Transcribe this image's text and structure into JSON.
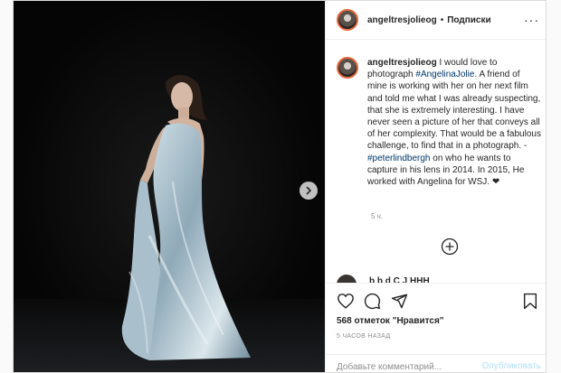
{
  "post": {
    "username": "angeltresjolieog",
    "separator": "•",
    "follow_label": "Подписки",
    "more_label": "···",
    "caption": {
      "username": "angeltresjolieog",
      "emoji_after_name": "",
      "text_1": "I would love to photograph ",
      "hashtag_1": "#AngelinaJolie",
      "text_2": ". A friend of mine is working with her on her next film and told me what I was already suspecting, that she is extremely interesting. I have never seen a picture of her that conveys all of her complexity. That would be a fabulous challenge, to find that in a photograph. - ",
      "mention_1": "#peterlindbergh",
      "text_3": " on who he wants to capture in his lens in 2014. In 2015, He worked with Angelina for WSJ. ❤",
      "time": "5 ч."
    },
    "partial_comment_text": "b           b       d     C         J HHH",
    "likes": "568 отметок \"Нравится\"",
    "time_ago": "5 ЧАСОВ НАЗАД",
    "comment_placeholder": "Добавьте комментарий...",
    "publish_label": "Опубликовать",
    "icons": {
      "like": "heart-icon",
      "comment": "comment-icon",
      "share": "share-icon",
      "save": "bookmark-icon",
      "next": "chevron-right-icon",
      "load_more": "plus-circle-icon"
    },
    "colors": {
      "link": "#00376b",
      "muted": "#8e8e8e",
      "publish_disabled": "#b2dffc",
      "story_ring": "#e6683c"
    }
  }
}
